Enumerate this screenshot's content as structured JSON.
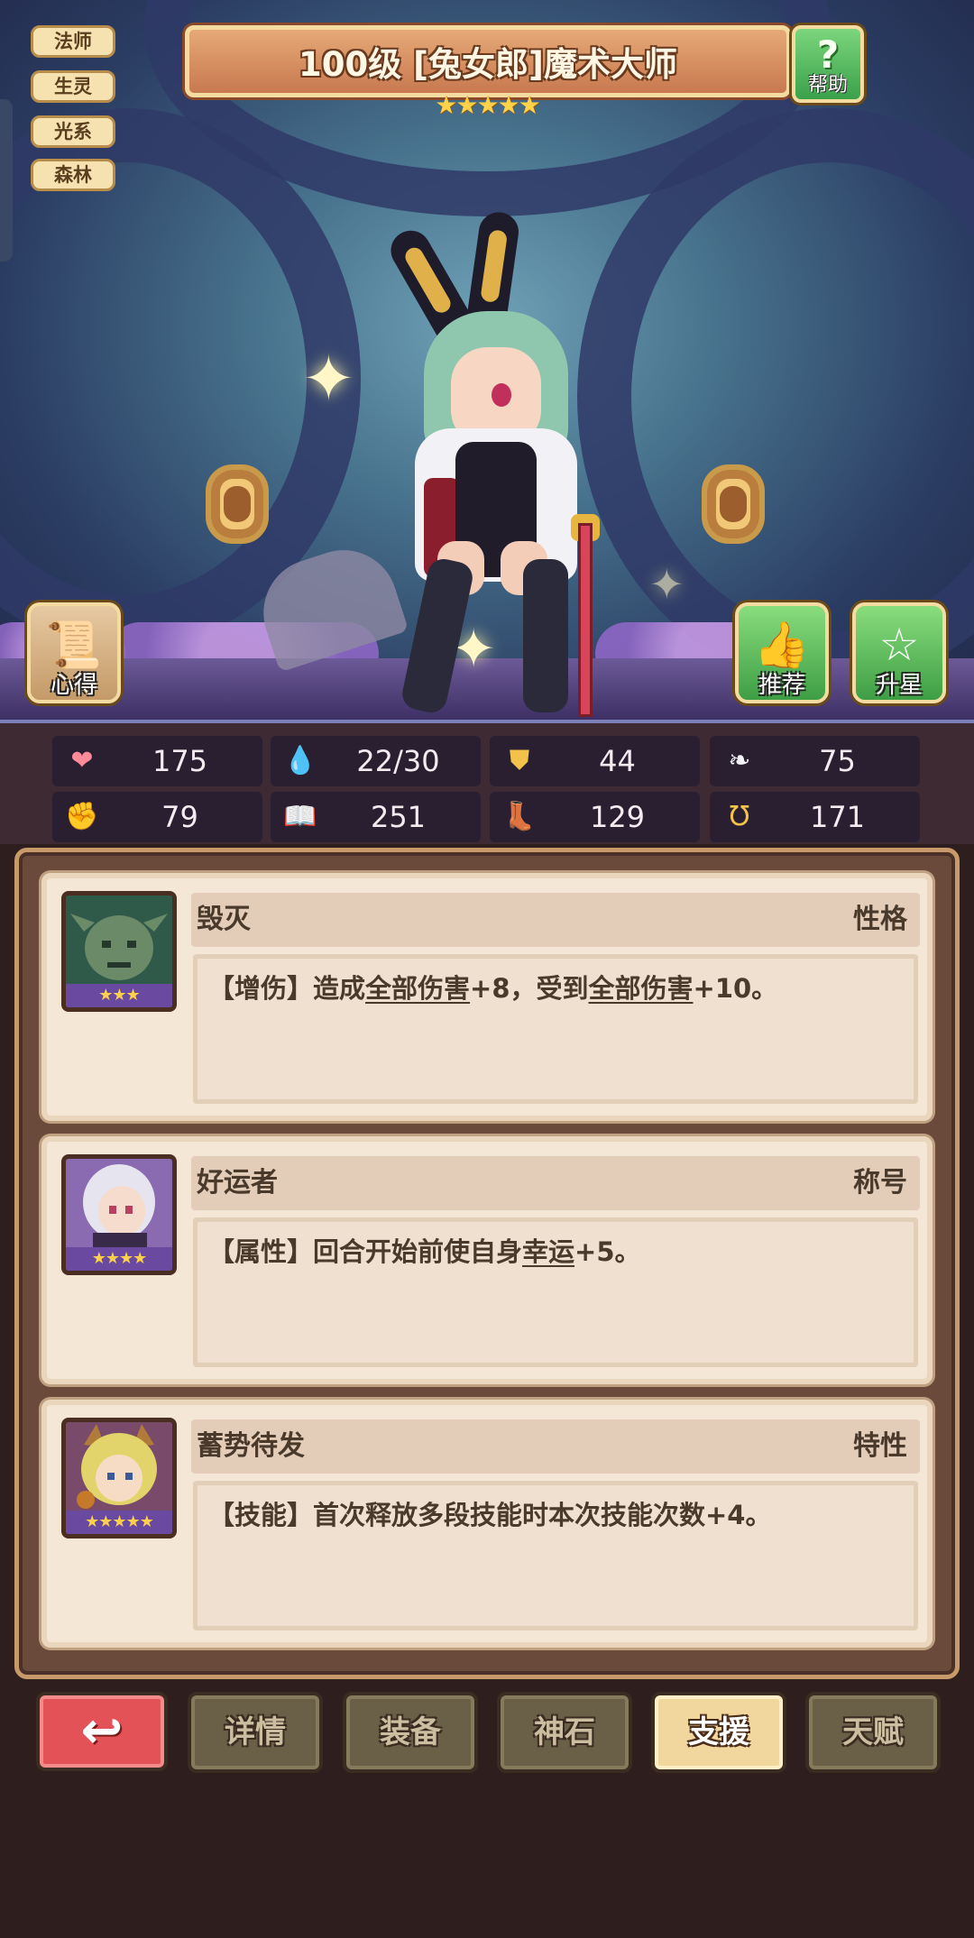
{
  "tags": [
    "法师",
    "生灵",
    "光系",
    "森林"
  ],
  "title": "100级 [兔女郎]魔术大师",
  "title_stars": "★★★★★",
  "help_label": "帮助",
  "left_button_label": "心得",
  "recommend_label": "推荐",
  "star_up_label": "升星",
  "stats": [
    {
      "icon": "heart-icon",
      "value": "175"
    },
    {
      "icon": "water-drop-icon",
      "value": "22/30"
    },
    {
      "icon": "shield-icon",
      "value": "44"
    },
    {
      "icon": "wing-icon",
      "value": "75"
    },
    {
      "icon": "fist-icon",
      "value": "79"
    },
    {
      "icon": "book-icon",
      "value": "251"
    },
    {
      "icon": "boot-icon",
      "value": "129"
    },
    {
      "icon": "horseshoe-icon",
      "value": "171"
    }
  ],
  "cards": [
    {
      "name": "毁灭",
      "kind": "性格",
      "stars": "★★★",
      "desc": {
        "p1": "【增伤】造成",
        "u1": "全部伤害",
        "p2": "+8，受到",
        "u2": "全部伤害",
        "p3": "+10。"
      }
    },
    {
      "name": "好运者",
      "kind": "称号",
      "stars": "★★★★",
      "desc": {
        "p1": "【属性】回合开始前使自身",
        "u1": "幸运",
        "p2": "+5。"
      }
    },
    {
      "name": "蓄势待发",
      "kind": "特性",
      "stars": "★★★★★",
      "desc": {
        "p1": "【技能】首次释放多段技能时本次技能次数+4。"
      }
    }
  ],
  "tabs": {
    "back": "↩",
    "details": "详情",
    "equipment": "装备",
    "god_stone": "神石",
    "support": "支援",
    "talent": "天赋"
  },
  "colors": {
    "accent_title": "#c8794f",
    "green_button": "#3e9e45",
    "back_red": "#e35256",
    "active_tab": "#f1d79e"
  }
}
